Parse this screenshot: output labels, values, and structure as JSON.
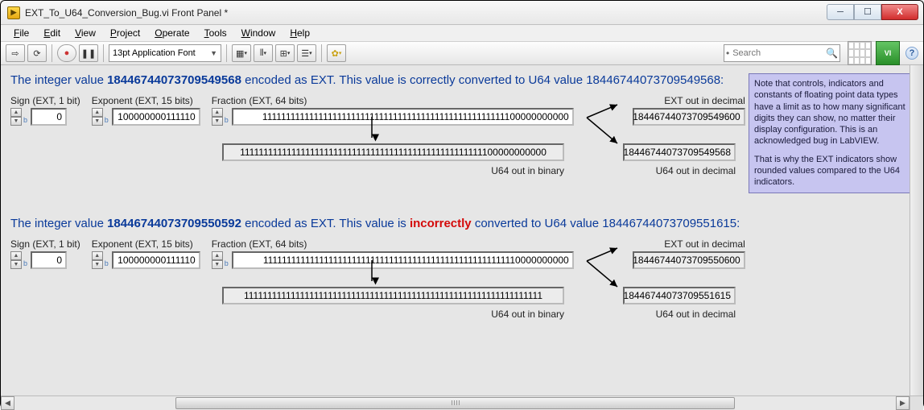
{
  "window": {
    "title": "EXT_To_U64_Conversion_Bug.vi Front Panel *"
  },
  "menu": {
    "file": "File",
    "edit": "Edit",
    "view": "View",
    "project": "Project",
    "operate": "Operate",
    "tools": "Tools",
    "window": "Window",
    "help": "Help"
  },
  "toolbar": {
    "font": "13pt Application Font",
    "search_placeholder": "Search"
  },
  "section1": {
    "heading_pre": "The integer value ",
    "heading_val": "18446744073709549568",
    "heading_mid": " encoded as EXT. This value is correctly converted to U64 value 18446744073709549568:",
    "sign_label": "Sign (EXT, 1 bit)",
    "sign_val": "0",
    "exp_label": "Exponent (EXT, 15 bits)",
    "exp_val": "100000000111110",
    "frac_label": "Fraction (EXT, 64 bits)",
    "frac_val": "1111111111111111111111111111111111111111111111111111100000000000",
    "ext_out_label": "EXT out in decimal",
    "ext_out_val": "18446744073709549600",
    "u64bin_label": "U64 out in binary",
    "u64bin_val": "1111111111111111111111111111111111111111111111111111100000000000",
    "u64dec_label": "U64 out in decimal",
    "u64dec_val": "18446744073709549568"
  },
  "section2": {
    "heading_pre": "The integer value ",
    "heading_val": "18446744073709550592",
    "heading_mid1": " encoded as EXT. This value is ",
    "heading_red": "incorrectly",
    "heading_mid2": " converted to U64 value 18446744073709551615:",
    "sign_label": "Sign (EXT, 1 bit)",
    "sign_val": "0",
    "exp_label": "Exponent (EXT, 15 bits)",
    "exp_val": "100000000111110",
    "frac_label": "Fraction (EXT, 64 bits)",
    "frac_val": "1111111111111111111111111111111111111111111111111111110000000000",
    "ext_out_label": "EXT out in decimal",
    "ext_out_val": "18446744073709550600",
    "u64bin_label": "U64 out in binary",
    "u64bin_val": "1111111111111111111111111111111111111111111111111111111111111111",
    "u64dec_label": "U64 out in decimal",
    "u64dec_val": "18446744073709551615"
  },
  "note": {
    "text1": "Note that controls, indicators and constants of floating point data types have a limit as to how many significant digits they can show, no matter their display configuration. This is an acknowledged bug in LabVIEW.",
    "text2": "That is why the EXT indicators show rounded values compared to the U64 indicators."
  }
}
